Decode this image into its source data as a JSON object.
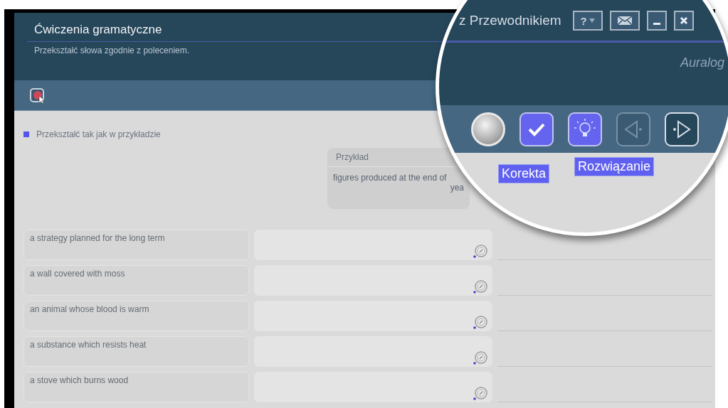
{
  "window": {
    "title": "Ćwiczenia gramatyczne",
    "subtitle": "Przekształć słowa zgodnie z poleceniem."
  },
  "instruction": "Przekształć tak jak w przykładzie",
  "example": {
    "heading": "Przykład",
    "line_1": "figures produced at the end of",
    "line_2": "yea"
  },
  "rows": [
    {
      "prompt": "a strategy planned for the long term"
    },
    {
      "prompt": "a wall covered with moss"
    },
    {
      "prompt": "an animal whose blood is warm"
    },
    {
      "prompt": "a substance which resists heat"
    },
    {
      "prompt": "a stove which burns wood"
    }
  ],
  "magnifier": {
    "window_title": "z Przewodnikiem",
    "help_button": "?",
    "logo": "Auralog",
    "tools": [
      {
        "kind": "sphere",
        "disabled": false
      },
      {
        "kind": "check",
        "disabled": false,
        "tooltip": "Korekta"
      },
      {
        "kind": "hint",
        "disabled": false,
        "tooltip": "Rozwiązanie"
      },
      {
        "kind": "back",
        "disabled": true
      },
      {
        "kind": "next",
        "disabled": false
      }
    ]
  }
}
